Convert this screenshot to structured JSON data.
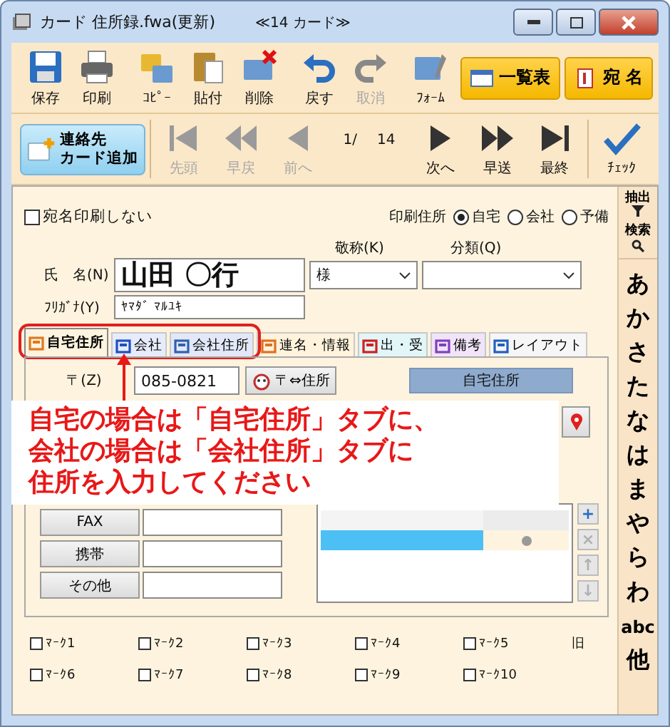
{
  "window": {
    "title": "カード 住所録.fwa(更新)",
    "subtitle": "≪14 カード≫"
  },
  "toolbar": {
    "items": [
      {
        "kind": "save",
        "label": "保存",
        "disabled": false
      },
      {
        "kind": "print",
        "label": "印刷",
        "disabled": false
      },
      {
        "kind": "copy",
        "label": "ｺﾋﾟｰ",
        "disabled": false
      },
      {
        "kind": "paste",
        "label": "貼付",
        "disabled": false
      },
      {
        "kind": "delete",
        "label": "削除",
        "disabled": false
      },
      {
        "kind": "undo",
        "label": "戻す",
        "disabled": false
      },
      {
        "kind": "redo",
        "label": "取消",
        "disabled": true
      },
      {
        "kind": "form",
        "label": "ﾌｫｰﾑ",
        "disabled": false
      }
    ],
    "views": [
      {
        "kind": "list",
        "label": "一覧表"
      },
      {
        "kind": "address",
        "label": "宛 名"
      }
    ]
  },
  "navigation": {
    "add_button": [
      "連絡先",
      "カード追加"
    ],
    "position": "1/",
    "total": "14",
    "buttons": [
      {
        "kind": "first",
        "label": "先頭",
        "disabled": true
      },
      {
        "kind": "rewind",
        "label": "早戻",
        "disabled": true
      },
      {
        "kind": "prev",
        "label": "前へ",
        "disabled": true
      },
      {
        "kind": "next",
        "label": "次へ",
        "disabled": false
      },
      {
        "kind": "forward",
        "label": "早送",
        "disabled": false
      },
      {
        "kind": "last",
        "label": "最終",
        "disabled": false
      }
    ],
    "check_button": "ﾁｪｯｸ"
  },
  "no_print": {
    "label": "宛名印刷しない",
    "checked": false
  },
  "print_address": {
    "label": "印刷住所",
    "options": [
      {
        "label": "自宅",
        "selected": true
      },
      {
        "label": "会社",
        "selected": false
      },
      {
        "label": "予備",
        "selected": false
      }
    ]
  },
  "name": {
    "label": "氏　名(N)",
    "value": "山田 〇行"
  },
  "furigana": {
    "label": "ﾌﾘｶﾞﾅ(Y)",
    "value": "ﾔﾏﾀﾞ ﾏﾙﾕｷ"
  },
  "honorific": {
    "label": "敬称(K)",
    "value": "様"
  },
  "category": {
    "label": "分類(Q)"
  },
  "tabs": [
    {
      "kind": "home",
      "label": "自宅住所",
      "selected": true
    },
    {
      "kind": "company",
      "label": "会社",
      "selected": false
    },
    {
      "kind": "company_address",
      "label": "会社住所",
      "selected": false
    },
    {
      "kind": "people",
      "label": "連名・情報",
      "selected": false
    },
    {
      "kind": "mail",
      "label": "出・受",
      "selected": false
    },
    {
      "kind": "note",
      "label": "備考",
      "selected": false
    },
    {
      "kind": "layout",
      "label": "レイアウト",
      "selected": false
    }
  ],
  "address_panel": {
    "postal_label": "〒(Z)",
    "postal_value": "085-0821",
    "convert_button": "〒⇔住所",
    "heading": "自宅住所",
    "contacts": [
      {
        "label": "FAX"
      },
      {
        "label": "携帯"
      },
      {
        "label": "その他"
      }
    ],
    "list_rows": [
      {
        "selected": false
      },
      {
        "selected": true
      }
    ],
    "list_buttons": [
      {
        "glyph": "+",
        "disabled": false
      },
      {
        "glyph": "×",
        "disabled": true
      },
      {
        "glyph": "↑",
        "disabled": true
      },
      {
        "glyph": "↓",
        "disabled": true
      }
    ]
  },
  "callout": [
    "自宅の場合は「自宅住所」タブに、",
    "会社の場合は「会社住所」タブに",
    "住所を入力してください"
  ],
  "marks": [
    {
      "label": "ﾏｰｸ1",
      "checked": false
    },
    {
      "label": "ﾏｰｸ2",
      "checked": false
    },
    {
      "label": "ﾏｰｸ3",
      "checked": false
    },
    {
      "label": "ﾏｰｸ4",
      "checked": false
    },
    {
      "label": "ﾏｰｸ5",
      "checked": false
    },
    {
      "label": "ﾏｰｸ6",
      "checked": false
    },
    {
      "label": "ﾏｰｸ7",
      "checked": false
    },
    {
      "label": "ﾏｰｸ8",
      "checked": false
    },
    {
      "label": "ﾏｰｸ9",
      "checked": false
    },
    {
      "label": "ﾏｰｸ10",
      "checked": false
    }
  ],
  "old_label": "旧",
  "index": {
    "filter": "抽出",
    "search": "検索",
    "letters": [
      "あ",
      "か",
      "さ",
      "た",
      "な",
      "は",
      "ま",
      "や",
      "ら",
      "わ",
      "abc",
      "他"
    ]
  }
}
